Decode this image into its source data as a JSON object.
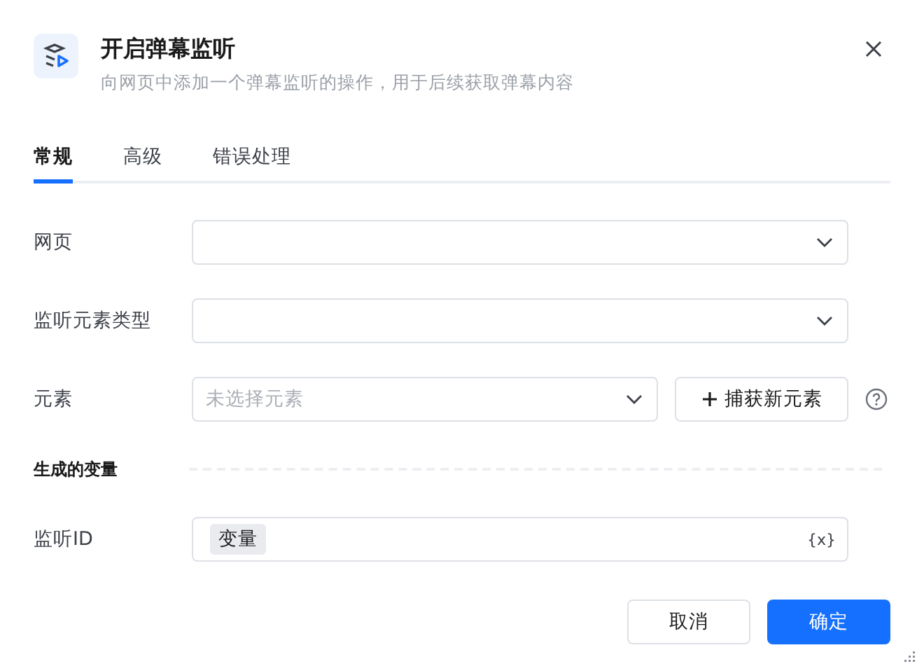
{
  "dialog": {
    "title": "开启弹幕监听",
    "subtitle": "向网页中添加一个弹幕监听的操作，用于后续获取弹幕内容"
  },
  "tabs": [
    {
      "label": "常规",
      "selected": true
    },
    {
      "label": "高级",
      "selected": false
    },
    {
      "label": "错误处理",
      "selected": false
    }
  ],
  "fields": [
    {
      "kind": "select",
      "label": "网页"
    },
    {
      "kind": "select",
      "label": "监听元素类型"
    },
    {
      "kind": "element",
      "label": "元素",
      "placeholder": "未选择元素",
      "button": "捕获新元素"
    }
  ],
  "section": {
    "title": "生成的变量"
  },
  "outputs": [
    {
      "label": "监听ID",
      "tag": "变量",
      "variable_symbol": "{x}"
    }
  ],
  "buttons": [
    {
      "label": "取消",
      "kind": "secondary"
    },
    {
      "label": "确定",
      "kind": "primary"
    }
  ]
}
